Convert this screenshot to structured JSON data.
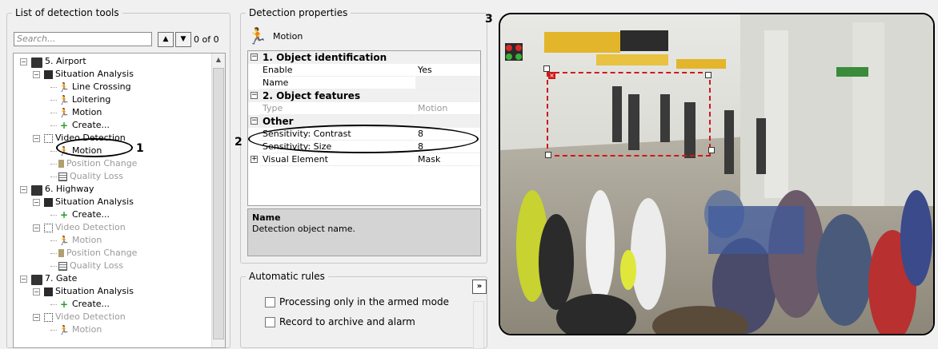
{
  "left_panel": {
    "title": "List of detection tools",
    "search_placeholder": "Search...",
    "counter": "0 of 0",
    "up_glyph": "▲",
    "down_glyph": "▼"
  },
  "tree": [
    {
      "label": "5. Airport",
      "level": 0,
      "icon": "camera-icon",
      "exp": "−",
      "dim": false
    },
    {
      "label": "Situation Analysis",
      "level": 1,
      "icon": "situation-analysis-icon",
      "exp": "−",
      "dim": false
    },
    {
      "label": "Line Crossing",
      "level": 2,
      "icon": "runner-icon",
      "dim": false
    },
    {
      "label": "Loitering",
      "level": 2,
      "icon": "runner-icon",
      "dim": false
    },
    {
      "label": "Motion",
      "level": 2,
      "icon": "runner-icon",
      "dim": false
    },
    {
      "label": "Create...",
      "level": 2,
      "icon": "plus-icon",
      "dim": false
    },
    {
      "label": "Video Detection",
      "level": 1,
      "icon": "video-detection-icon",
      "exp": "−",
      "dim": false
    },
    {
      "label": "Motion",
      "level": 2,
      "icon": "runner-icon",
      "dim": false
    },
    {
      "label": "Position Change",
      "level": 2,
      "icon": "position-change-icon",
      "dim": true
    },
    {
      "label": "Quality Loss",
      "level": 2,
      "icon": "quality-loss-icon",
      "dim": true
    },
    {
      "label": "6. Highway",
      "level": 0,
      "icon": "camera-icon",
      "exp": "−",
      "dim": false
    },
    {
      "label": "Situation Analysis",
      "level": 1,
      "icon": "situation-analysis-icon",
      "exp": "−",
      "dim": false
    },
    {
      "label": "Create...",
      "level": 2,
      "icon": "plus-icon",
      "dim": false
    },
    {
      "label": "Video Detection",
      "level": 1,
      "icon": "video-detection-icon",
      "exp": "−",
      "dim": true
    },
    {
      "label": "Motion",
      "level": 2,
      "icon": "runner-icon",
      "dim": true
    },
    {
      "label": "Position Change",
      "level": 2,
      "icon": "position-change-icon",
      "dim": true
    },
    {
      "label": "Quality Loss",
      "level": 2,
      "icon": "quality-loss-icon",
      "dim": true
    },
    {
      "label": "7. Gate",
      "level": 0,
      "icon": "camera-icon",
      "exp": "−",
      "dim": false
    },
    {
      "label": "Situation Analysis",
      "level": 1,
      "icon": "situation-analysis-icon",
      "exp": "−",
      "dim": false
    },
    {
      "label": "Create...",
      "level": 2,
      "icon": "plus-icon",
      "dim": false
    },
    {
      "label": "Video Detection",
      "level": 1,
      "icon": "video-detection-icon",
      "exp": "−",
      "dim": true
    },
    {
      "label": "Motion",
      "level": 2,
      "icon": "runner-icon",
      "dim": true
    }
  ],
  "annotations": {
    "a1": "1",
    "a2": "2",
    "a3": "3"
  },
  "props": {
    "title": "Detection properties",
    "tool_name": "Motion",
    "rows": [
      {
        "kind": "cat",
        "key": "1. Object identification",
        "exp": "−"
      },
      {
        "kind": "row",
        "key": "Enable",
        "value": "Yes"
      },
      {
        "kind": "row",
        "key": "Name",
        "value": "",
        "gray": true
      },
      {
        "kind": "cat",
        "key": "2. Object features",
        "exp": "−"
      },
      {
        "kind": "row",
        "key": "Type",
        "value": "Motion",
        "dim": true
      },
      {
        "kind": "cat",
        "key": "Other",
        "exp": "−"
      },
      {
        "kind": "row",
        "key": "Sensitivity: Contrast",
        "value": "8"
      },
      {
        "kind": "row",
        "key": "Sensitivity: Size",
        "value": "8"
      },
      {
        "kind": "collapsed",
        "key": "Visual Element",
        "value": "Mask",
        "exp": "+"
      }
    ],
    "desc_title": "Name",
    "desc_text": "Detection object name."
  },
  "rules": {
    "title": "Automatic rules",
    "expand_glyph": "»",
    "armed_label": "Processing only in the armed mode",
    "record_label": "Record to archive and alarm"
  },
  "colors": {
    "area_outline": "#d01818",
    "selection_ellipse": "#000000"
  }
}
